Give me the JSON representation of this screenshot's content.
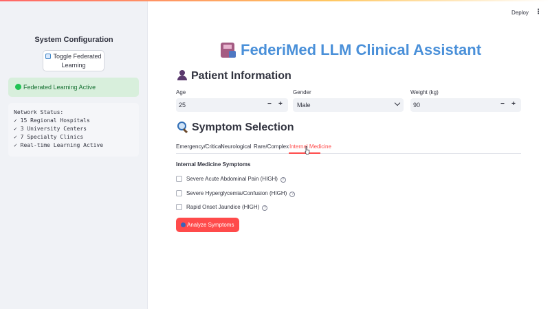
{
  "header": {
    "deploy_label": "Deploy",
    "menu_icon": "vertical-dots-icon",
    "accent_colors": [
      "#ff4b4b",
      "#ffbd45"
    ]
  },
  "sidebar": {
    "title": "System Configuration",
    "toggle_button_label": "Toggle Federated Learning",
    "toggle_button_icon": "refresh-icon",
    "status_text": "Federated Learning Active",
    "status_color": "#21c354",
    "network_lines": [
      "Network Status:",
      "✓ 15 Regional Hospitals",
      "✓ 3 University Centers",
      "✓ 7 Specialty Clinics",
      "✓ Real-time Learning Active"
    ]
  },
  "main": {
    "title": "FederiMed LLM Clinical Assistant",
    "title_color": "#4a90d9",
    "title_icon": "floppy-disk-icon",
    "patient_section": {
      "heading": "Patient Information",
      "icon": "person-icon",
      "age": {
        "label": "Age",
        "value": "25"
      },
      "gender": {
        "label": "Gender",
        "value": "Male"
      },
      "weight": {
        "label": "Weight (kg)",
        "value": "90"
      },
      "minus": "−",
      "plus": "+"
    },
    "symptom_section": {
      "heading": "Symptom Selection",
      "icon": "magnifying-glass-icon",
      "tabs": [
        "Emergency/Critical",
        "Neurological",
        "Rare/Complex",
        "Internal Medicine"
      ],
      "active_tab": "Internal Medicine",
      "subheading": "Internal Medicine Symptoms",
      "symptoms": [
        "Severe Acute Abdominal Pain (HIGH)",
        "Severe Hyperglycemia/Confusion (HIGH)",
        "Rapid Onset Jaundice (HIGH)"
      ],
      "help_glyph": "?",
      "analyze_label": "Analyze Symptoms",
      "analyze_color": "#ff4b4b"
    }
  }
}
